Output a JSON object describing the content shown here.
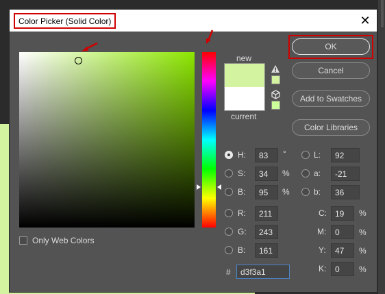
{
  "dialog": {
    "title": "Color Picker (Solid Color)",
    "close_glyph": "✕"
  },
  "colors": {
    "new_color": "#d3f3a1",
    "current_color": "#ffffff",
    "highlight": "#d00000"
  },
  "preview": {
    "new_label": "new",
    "current_label": "current"
  },
  "buttons": {
    "ok": "OK",
    "cancel": "Cancel",
    "add_to_swatches": "Add to Swatches",
    "color_libraries": "Color Libraries"
  },
  "hsb": {
    "h": {
      "label": "H:",
      "value": "83",
      "unit": "°"
    },
    "s": {
      "label": "S:",
      "value": "34",
      "unit": "%"
    },
    "b": {
      "label": "B:",
      "value": "95",
      "unit": "%"
    }
  },
  "rgb": {
    "r": {
      "label": "R:",
      "value": "211"
    },
    "g": {
      "label": "G:",
      "value": "243"
    },
    "b": {
      "label": "B:",
      "value": "161"
    }
  },
  "lab": {
    "l": {
      "label": "L:",
      "value": "92"
    },
    "a": {
      "label": "a:",
      "value": "-21"
    },
    "b": {
      "label": "b:",
      "value": "36"
    }
  },
  "cmyk": {
    "c": {
      "label": "C:",
      "value": "19",
      "unit": "%"
    },
    "m": {
      "label": "M:",
      "value": "0",
      "unit": "%"
    },
    "y": {
      "label": "Y:",
      "value": "47",
      "unit": "%"
    },
    "k": {
      "label": "K:",
      "value": "0",
      "unit": "%"
    }
  },
  "hex": {
    "label": "#",
    "value": "d3f3a1"
  },
  "only_web_colors": {
    "label": "Only Web Colors",
    "checked": false
  },
  "selected_channel": "H"
}
